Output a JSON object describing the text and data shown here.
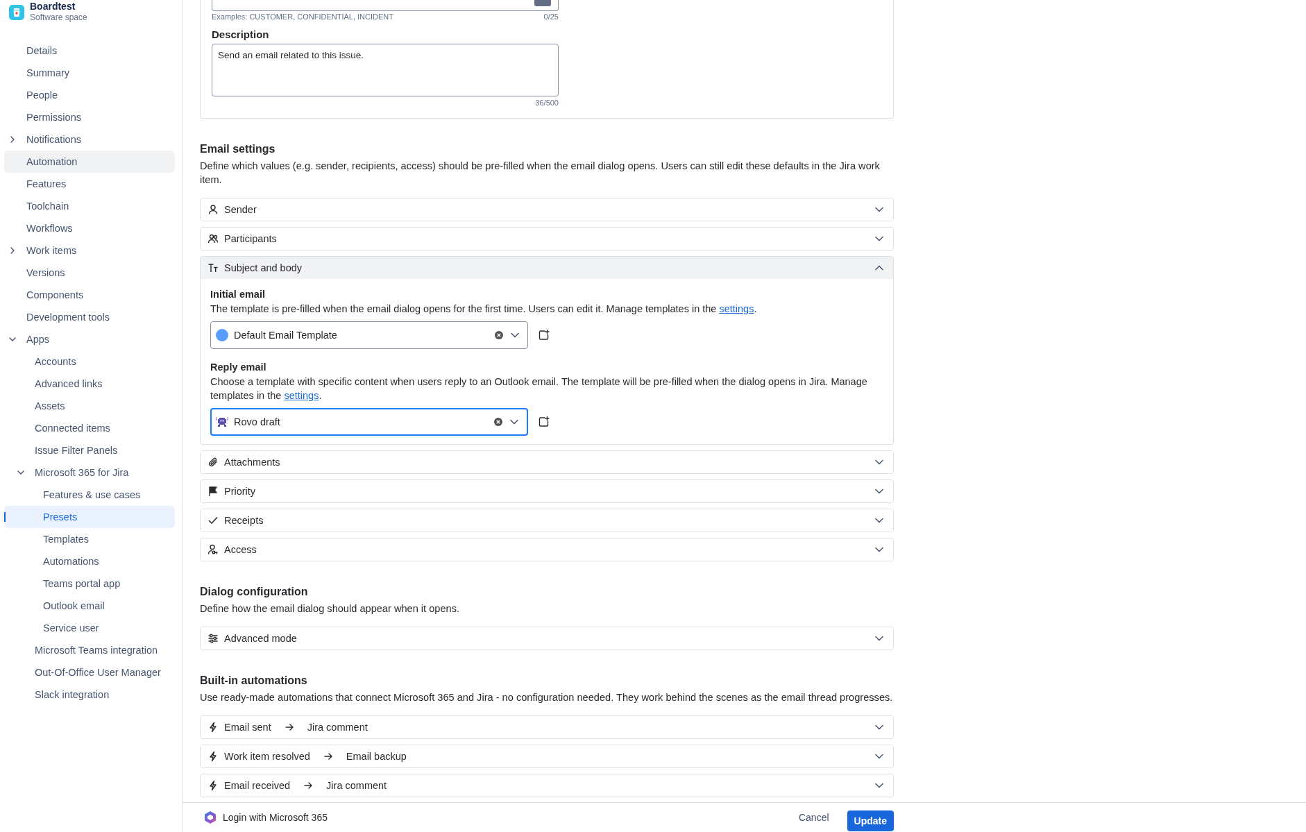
{
  "sidebar": {
    "space": {
      "name": "Boardtest",
      "type": "Software space"
    },
    "items": [
      {
        "label": "Details",
        "selected": false,
        "hovered": false
      },
      {
        "label": "Summary",
        "selected": false,
        "hovered": false
      },
      {
        "label": "People",
        "selected": false,
        "hovered": false
      },
      {
        "label": "Permissions",
        "selected": false,
        "hovered": false
      },
      {
        "label": "Notifications",
        "selected": false,
        "hovered": false,
        "expanded": false
      },
      {
        "label": "Automation",
        "selected": false,
        "hovered": true
      },
      {
        "label": "Features",
        "selected": false,
        "hovered": false
      },
      {
        "label": "Toolchain",
        "selected": false,
        "hovered": false
      },
      {
        "label": "Workflows",
        "selected": false,
        "hovered": false
      },
      {
        "label": "Work items",
        "selected": false,
        "hovered": false,
        "expanded": false
      },
      {
        "label": "Versions",
        "selected": false,
        "hovered": false
      },
      {
        "label": "Components",
        "selected": false,
        "hovered": false
      },
      {
        "label": "Development tools",
        "selected": false,
        "hovered": false
      },
      {
        "label": "Apps",
        "selected": false,
        "hovered": false,
        "expanded": true,
        "children": [
          {
            "label": "Accounts",
            "selected": false,
            "hovered": false
          },
          {
            "label": "Advanced links",
            "selected": false,
            "hovered": false
          },
          {
            "label": "Assets",
            "selected": false,
            "hovered": false
          },
          {
            "label": "Connected items",
            "selected": false,
            "hovered": false
          },
          {
            "label": "Issue Filter Panels",
            "selected": false,
            "hovered": false
          },
          {
            "label": "Microsoft 365 for Jira",
            "selected": false,
            "hovered": false,
            "expanded": true,
            "children": [
              {
                "label": "Features & use cases",
                "selected": false,
                "hovered": false
              },
              {
                "label": "Presets",
                "selected": true,
                "hovered": false
              },
              {
                "label": "Templates",
                "selected": false,
                "hovered": false
              },
              {
                "label": "Automations",
                "selected": false,
                "hovered": false
              },
              {
                "label": "Teams portal app",
                "selected": false,
                "hovered": false
              },
              {
                "label": "Outlook email",
                "selected": false,
                "hovered": false
              },
              {
                "label": "Service user",
                "selected": false,
                "hovered": false
              }
            ]
          },
          {
            "label": "Microsoft Teams integration",
            "selected": false,
            "hovered": false
          },
          {
            "label": "Out-Of-Office User Manager",
            "selected": false,
            "hovered": false
          },
          {
            "label": "Slack integration",
            "selected": false,
            "hovered": false
          }
        ]
      }
    ]
  },
  "preset_card": {
    "tag_hint": "Examples: CUSTOMER, CONFIDENTIAL, INCIDENT",
    "tag_counter": "0/25",
    "description_label": "Description",
    "description_value": "Send an email related to this issue.",
    "description_counter": "36/500"
  },
  "email_settings": {
    "title": "Email settings",
    "description": "Define which values (e.g. sender, recipients, access) should be pre-filled when the email dialog opens. Users can still edit these defaults in the Jira work item.",
    "sections": [
      {
        "label": "Sender",
        "kind": "person",
        "expanded": false
      },
      {
        "label": "Participants",
        "kind": "people",
        "expanded": false
      },
      {
        "label": "Subject and body",
        "kind": "text",
        "expanded": true,
        "templates": [
          {
            "label": "Initial email",
            "text": "The template is pre-filled when the email dialog opens for the first time. Users can edit it. Manage templates in the ",
            "link": "settings",
            "text_end": ".",
            "value": "Default Email Template",
            "kind": "circle",
            "focused": false
          },
          {
            "label": "Reply email",
            "text": "Choose a template with specific content when users reply to an Outlook email. The template will be pre-filled when the dialog opens in Jira. Manage templates in the ",
            "link": "settings",
            "text_end": ".",
            "value": "Rovo draft",
            "kind": "robot",
            "focused": true
          }
        ]
      },
      {
        "label": "Attachments",
        "kind": "paperclip",
        "expanded": false
      },
      {
        "label": "Priority",
        "kind": "flag",
        "expanded": false
      },
      {
        "label": "Receipts",
        "kind": "check",
        "expanded": false
      },
      {
        "label": "Access",
        "kind": "person-key",
        "expanded": false
      }
    ]
  },
  "dialog_configuration": {
    "title": "Dialog configuration",
    "description": "Define how the email dialog should appear when it opens.",
    "sections": [
      {
        "label": "Advanced mode",
        "kind": "sliders",
        "expanded": false
      }
    ]
  },
  "built_in_automations": {
    "title": "Built-in automations",
    "description": "Use ready-made automations that connect Microsoft 365 and Jira - no configuration needed. They work behind the scenes as the email thread progresses.",
    "automations": [
      {
        "trigger": "Email sent",
        "action": "Jira comment",
        "expanded": false
      },
      {
        "trigger": "Work item resolved",
        "action": "Email backup",
        "expanded": false
      },
      {
        "trigger": "Email received",
        "action": "Jira comment",
        "expanded": false
      }
    ]
  },
  "footer": {
    "login": "Login with Microsoft 365",
    "cancel": "Cancel",
    "update": "Update"
  }
}
